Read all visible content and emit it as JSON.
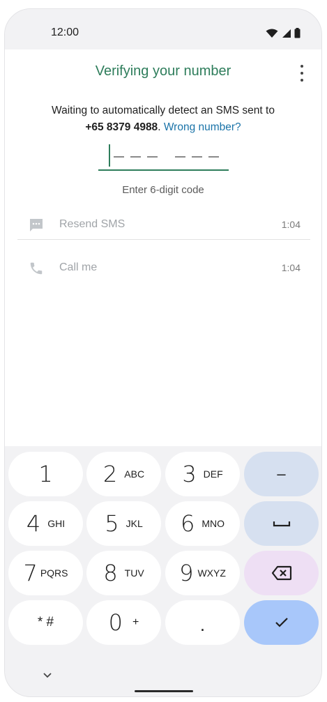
{
  "status_bar": {
    "time": "12:00"
  },
  "header": {
    "title": "Verifying your number"
  },
  "message": {
    "line1": "Waiting to automatically detect an SMS sent to",
    "phone": "+65 8379 4988",
    "separator": ". ",
    "link": "Wrong number?"
  },
  "code_input": {
    "hint": "Enter 6-digit code"
  },
  "options": [
    {
      "label": "Resend SMS",
      "timer": "1:04",
      "icon": "message-icon"
    },
    {
      "label": "Call me",
      "timer": "1:04",
      "icon": "phone-icon"
    }
  ],
  "keypad": {
    "keys": [
      {
        "digit": "1",
        "letters": ""
      },
      {
        "digit": "2",
        "letters": "ABC"
      },
      {
        "digit": "3",
        "letters": "DEF"
      },
      {
        "digit": "4",
        "letters": "GHI"
      },
      {
        "digit": "5",
        "letters": "JKL"
      },
      {
        "digit": "6",
        "letters": "MNO"
      },
      {
        "digit": "7",
        "letters": "PQRS"
      },
      {
        "digit": "8",
        "letters": "TUV"
      },
      {
        "digit": "9",
        "letters": "WXYZ"
      },
      {
        "digit": "0",
        "letters": "+"
      }
    ],
    "symbols": {
      "star_hash": "* #",
      "period": ".",
      "minus": "–"
    }
  },
  "colors": {
    "accent": "#2e7d5b",
    "link": "#1a73a8",
    "fn_key": "#d6e0f0",
    "delete_key": "#eedff4",
    "ok_key": "#a8c7fa"
  }
}
